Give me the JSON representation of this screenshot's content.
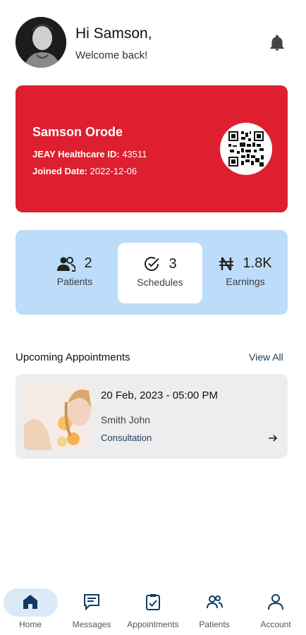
{
  "header": {
    "greeting": "Hi Samson,",
    "subtitle": "Welcome back!",
    "notification_icon": "bell-icon"
  },
  "id_card": {
    "name": "Samson Orode",
    "id_label": "JEAY Healthcare ID:",
    "id_value": "43511",
    "joined_label": "Joined Date:",
    "joined_value": "2022-12-06",
    "background_color": "#dd1f30",
    "qr_icon": "qr-code-icon"
  },
  "stats": [
    {
      "icon": "people-icon",
      "value": "2",
      "label": "Patients"
    },
    {
      "icon": "check-circle-icon",
      "value": "3",
      "label": "Schedules"
    },
    {
      "icon": "naira-icon",
      "value": "1.8K",
      "label": "Earnings"
    }
  ],
  "upcoming": {
    "title": "Upcoming Appointments",
    "view_all": "View All",
    "appointments": [
      {
        "datetime": "20 Feb, 2023 - 05:00 PM",
        "patient": "Smith John",
        "type": "Consultation"
      }
    ]
  },
  "nav": {
    "active": "Home",
    "items": [
      {
        "icon": "home-icon",
        "label": "Home"
      },
      {
        "icon": "messages-icon",
        "label": "Messages"
      },
      {
        "icon": "appointments-icon",
        "label": "Appointments"
      },
      {
        "icon": "patients-icon",
        "label": "Patients"
      },
      {
        "icon": "account-icon",
        "label": "Account"
      }
    ]
  },
  "colors": {
    "accent_red": "#dd1f30",
    "stats_bg": "#bcdcf9",
    "nav_active_bg": "#dce9f6",
    "link_blue": "#1b3a5c"
  }
}
